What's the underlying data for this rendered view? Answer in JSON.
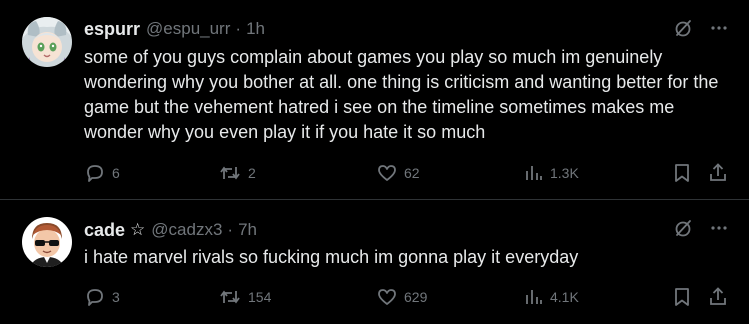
{
  "posts": [
    {
      "display_name": "espurr",
      "handle": "@espu_urr",
      "separator": "·",
      "time": "1h",
      "badge": "",
      "text": "some of you guys complain about games you play so much im genuinely wondering why you bother at all. one thing is criticism and wanting better for the game but the vehement hatred i see on the timeline sometimes makes me wonder why you even play it if you hate it so much",
      "stats": {
        "replies": "6",
        "reposts": "2",
        "likes": "62",
        "views": "1.3K"
      }
    },
    {
      "display_name": "cade",
      "handle": "@cadzx3",
      "separator": "·",
      "time": "7h",
      "badge": "☆",
      "text": "i hate marvel rivals so fucking much im gonna play it everyday",
      "stats": {
        "replies": "3",
        "reposts": "154",
        "likes": "629",
        "views": "4.1K"
      }
    }
  ],
  "icons": {
    "grok": "grok-slash-circle-icon",
    "more": "more-dots-icon",
    "reply": "reply-bubble-icon",
    "repost": "repost-arrows-icon",
    "like": "heart-icon",
    "views": "views-bars-icon",
    "bookmark": "bookmark-icon",
    "share": "share-upload-icon"
  },
  "colors": {
    "background": "#000000",
    "text": "#e7e9ea",
    "muted": "#71767b",
    "divider": "#2f3336"
  }
}
